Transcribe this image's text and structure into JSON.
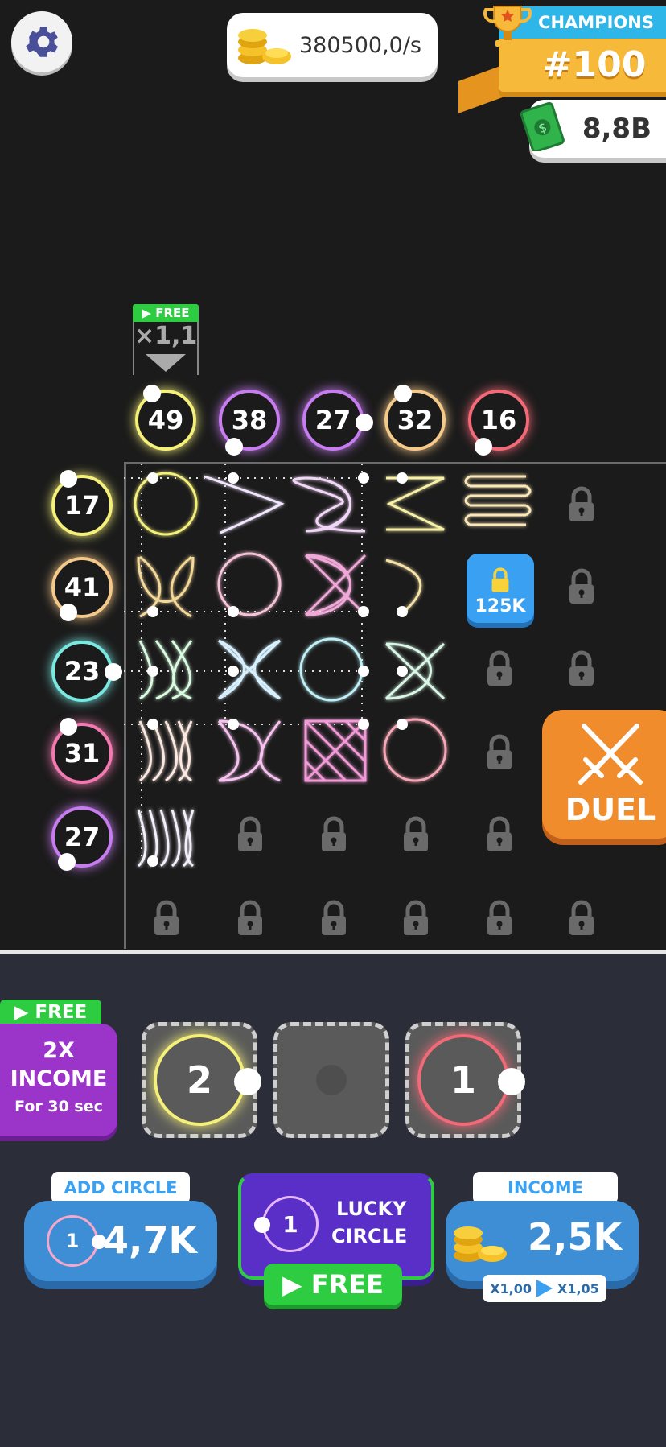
{
  "hud": {
    "coins_rate": "380500,0/s",
    "champions_label": "CHAMPIONS",
    "champions_rank": "#100",
    "cash": "8,8B"
  },
  "column_boost": {
    "free_label": "▶ FREE",
    "multiplier": "×1,1"
  },
  "column_heads": [
    "49",
    "38",
    "27",
    "32",
    "16"
  ],
  "row_heads": [
    "17",
    "41",
    "23",
    "31",
    "27"
  ],
  "lock_price": "125K",
  "duel_label": "DUEL",
  "income_boost": {
    "free_label": "▶ FREE",
    "line1": "2X",
    "line2": "INCOME",
    "line3": "For 30 sec"
  },
  "slots": [
    "2",
    "",
    "1"
  ],
  "add_circle": {
    "tag": "ADD CIRCLE",
    "level": "1",
    "price": "4,7K"
  },
  "lucky_circle": {
    "level": "1",
    "line1": "LUCKY",
    "line2": "CIRCLE",
    "free_label": "▶ FREE"
  },
  "income": {
    "tag": "INCOME",
    "value": "2,5K",
    "from": "X1,00",
    "to": "X1,05"
  },
  "colors": {
    "yellow": "#f4f07a",
    "purple": "#c77cf0",
    "orange": "#f4c98a",
    "pink": "#f27ab0",
    "teal": "#7ae7e0",
    "red": "#f26a78",
    "green": "#2ecc40",
    "blue": "#3e8ed6",
    "orange_btn": "#f08c2c"
  }
}
